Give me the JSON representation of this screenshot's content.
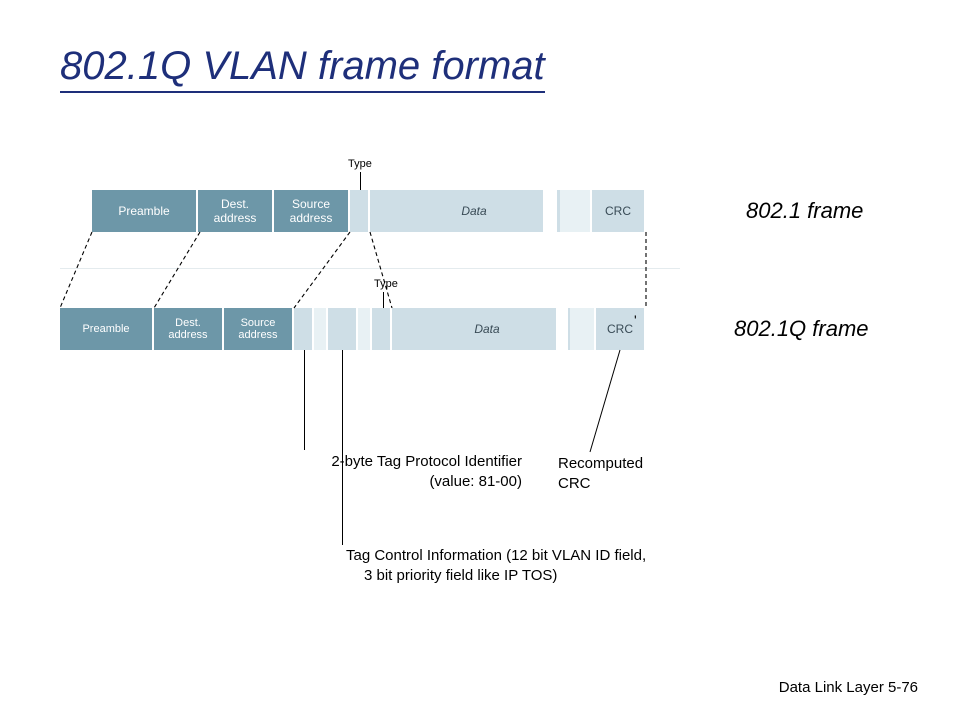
{
  "title": "802.1Q VLAN frame format",
  "type_label": "Type",
  "frame1_label": "802.1 frame",
  "frame2_label": "802.1Q frame",
  "frame1": {
    "preamble": "Preamble",
    "dest": "Dest.\naddress",
    "source": "Source\naddress",
    "data": "Data",
    "crc": "CRC"
  },
  "frame2": {
    "preamble": "Preamble",
    "dest": "Dest.\naddress",
    "source": "Source\naddress",
    "data": "Data",
    "crc": "CRC"
  },
  "annotations": {
    "tpid_line1": "2-byte Tag Protocol Identifier",
    "tpid_line2": "(value: 81-00)",
    "crc": "Recomputed\nCRC",
    "tci_line1": "Tag Control Information (12 bit VLAN ID field,",
    "tci_line2": "3 bit priority field like IP TOS)"
  },
  "footer": "Data Link Layer  5-76"
}
